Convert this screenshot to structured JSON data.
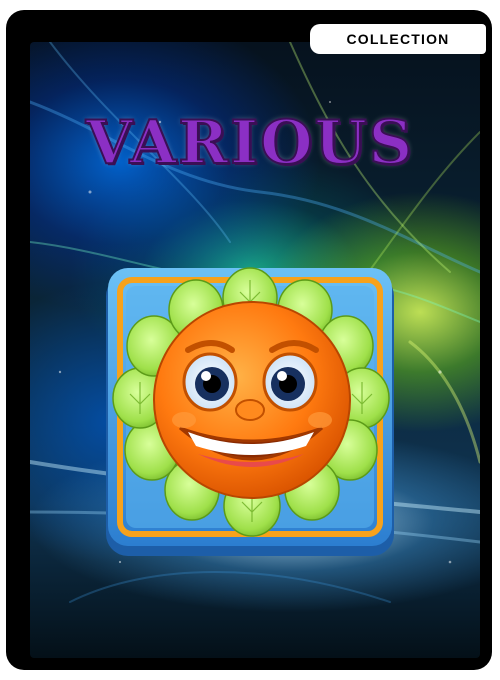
{
  "badge": {
    "label": "COLLECTION"
  },
  "title": "VARIOUS",
  "colors": {
    "title": "#8b2fc4",
    "icon_face": "#ff7a10",
    "petals": "#9fe04a",
    "tile_border": "#f7a21b",
    "tile": "#4aa6e8"
  },
  "icon": {
    "name": "smiling-flower-icon"
  }
}
